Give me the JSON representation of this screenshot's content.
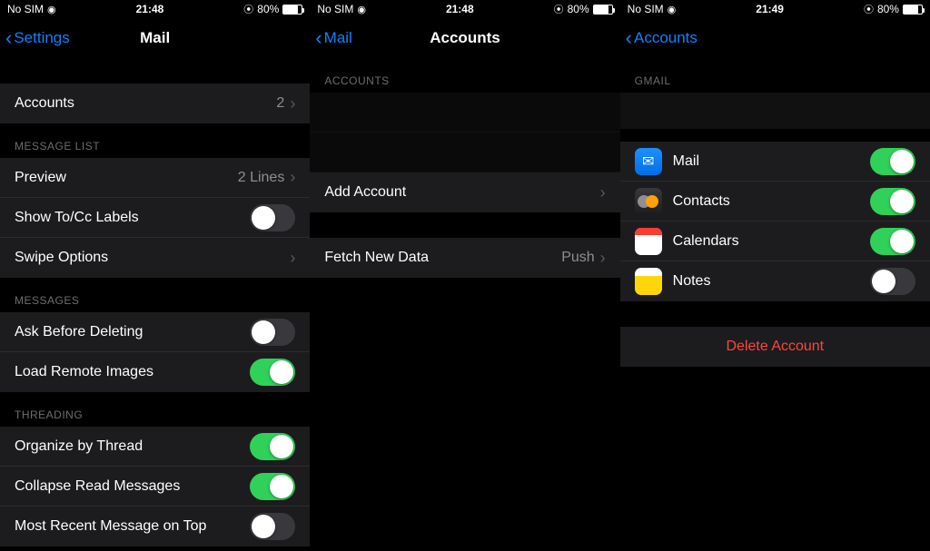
{
  "status": {
    "carrier": "No SIM",
    "time1": "21:48",
    "time2": "21:48",
    "time3": "21:49",
    "battery": "80%"
  },
  "screen1": {
    "back": "Settings",
    "title": "Mail",
    "accounts": {
      "label": "Accounts",
      "value": "2"
    },
    "section_messagelist": "MESSAGE LIST",
    "preview": {
      "label": "Preview",
      "value": "2 Lines"
    },
    "showtocc": {
      "label": "Show To/Cc Labels",
      "on": false
    },
    "swipe": {
      "label": "Swipe Options"
    },
    "section_messages": "MESSAGES",
    "askdelete": {
      "label": "Ask Before Deleting",
      "on": false
    },
    "loadremote": {
      "label": "Load Remote Images",
      "on": true
    },
    "section_threading": "THREADING",
    "organize": {
      "label": "Organize by Thread",
      "on": true
    },
    "collapse": {
      "label": "Collapse Read Messages",
      "on": true
    },
    "recent": {
      "label": "Most Recent Message on Top",
      "on": false
    }
  },
  "screen2": {
    "back": "Mail",
    "title": "Accounts",
    "section_accounts": "ACCOUNTS",
    "addaccount": "Add Account",
    "fetch": {
      "label": "Fetch New Data",
      "value": "Push"
    }
  },
  "screen3": {
    "back": "Accounts",
    "section_gmail": "GMAIL",
    "mail": {
      "label": "Mail",
      "on": true
    },
    "contacts": {
      "label": "Contacts",
      "on": true
    },
    "calendars": {
      "label": "Calendars",
      "on": true
    },
    "notes": {
      "label": "Notes",
      "on": false
    },
    "delete": "Delete Account"
  }
}
